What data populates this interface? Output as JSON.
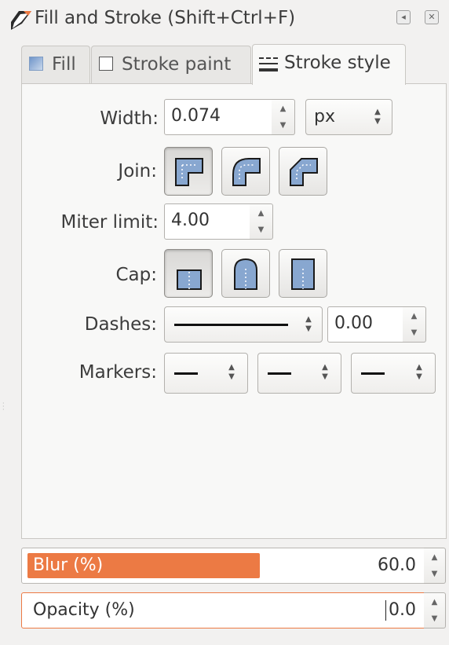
{
  "window": {
    "title": "Fill and Stroke (Shift+Ctrl+F)",
    "float_btn": "◂",
    "close_btn": "✕"
  },
  "tabs": [
    {
      "label": "Fill"
    },
    {
      "label": "Stroke paint"
    },
    {
      "label": "Stroke style"
    }
  ],
  "stroke_style": {
    "width_label": "Width:",
    "width_value": "0.074",
    "unit": "px",
    "join_label": "Join:",
    "join_options": [
      "miter",
      "round",
      "bevel"
    ],
    "join_selected": "miter",
    "miter_label": "Miter limit:",
    "miter_value": "4.00",
    "cap_label": "Cap:",
    "cap_options": [
      "butt",
      "round",
      "square"
    ],
    "cap_selected": "butt",
    "dashes_label": "Dashes:",
    "dash_offset": "0.00",
    "markers_label": "Markers:"
  },
  "blur": {
    "label": "Blur (%)",
    "value": "60.0",
    "fraction": 0.6
  },
  "opacity": {
    "label": "Opacity (%)",
    "value": "0.0",
    "fraction": 0.0
  },
  "colors": {
    "accent": "#ec7a44",
    "icon_blue": "#88a7d0"
  }
}
